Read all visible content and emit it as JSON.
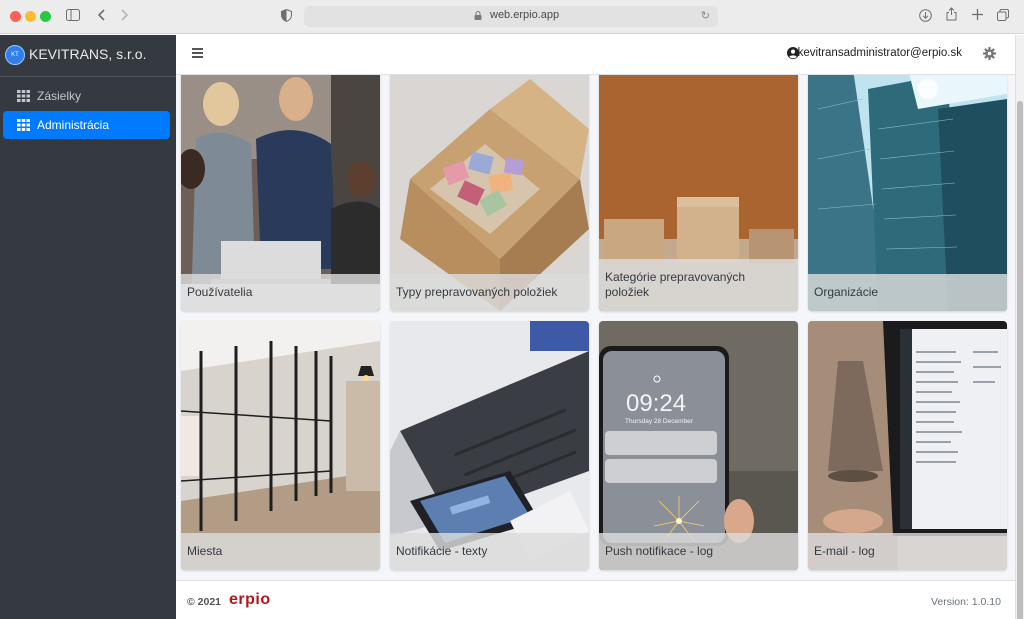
{
  "browser": {
    "url": "web.erpio.app",
    "icons": [
      "sidebar-toggle-icon",
      "back-icon",
      "forward-icon",
      "shield-icon",
      "lock-icon",
      "reload-icon",
      "download-icon",
      "share-icon",
      "new-tab-icon",
      "tabs-overview-icon"
    ]
  },
  "sidebar": {
    "logo_text": "KT",
    "company": "KEVITRANS, s.r.o.",
    "items": [
      {
        "label": "Zásielky",
        "icon": "grid-icon",
        "active": false
      },
      {
        "label": "Administrácia",
        "icon": "grid-icon",
        "active": true
      }
    ]
  },
  "topbar": {
    "user_email": "kevitransadministrator@erpio.sk",
    "icons": [
      "menu-icon",
      "user-icon",
      "gear-icon"
    ]
  },
  "tiles": [
    {
      "label": "Používatelia"
    },
    {
      "label": "Typy prepravovaných položiek"
    },
    {
      "label": "Kategórie prepravovaných položiek"
    },
    {
      "label": "Organizácie"
    },
    {
      "label": "Miesta"
    },
    {
      "label": "Notifikácie - texty"
    },
    {
      "label": "Push notifikace - log"
    },
    {
      "label": "E-mail - log"
    }
  ],
  "phone": {
    "time": "09:24",
    "date": "Thursday 28 December"
  },
  "footer": {
    "copyright": "© 2021",
    "brand": "erpio",
    "version": "Version: 1.0.10"
  },
  "colors": {
    "sidebar_bg": "#343a40",
    "active_item": "#007bff",
    "brand_red": "#b0161e"
  }
}
